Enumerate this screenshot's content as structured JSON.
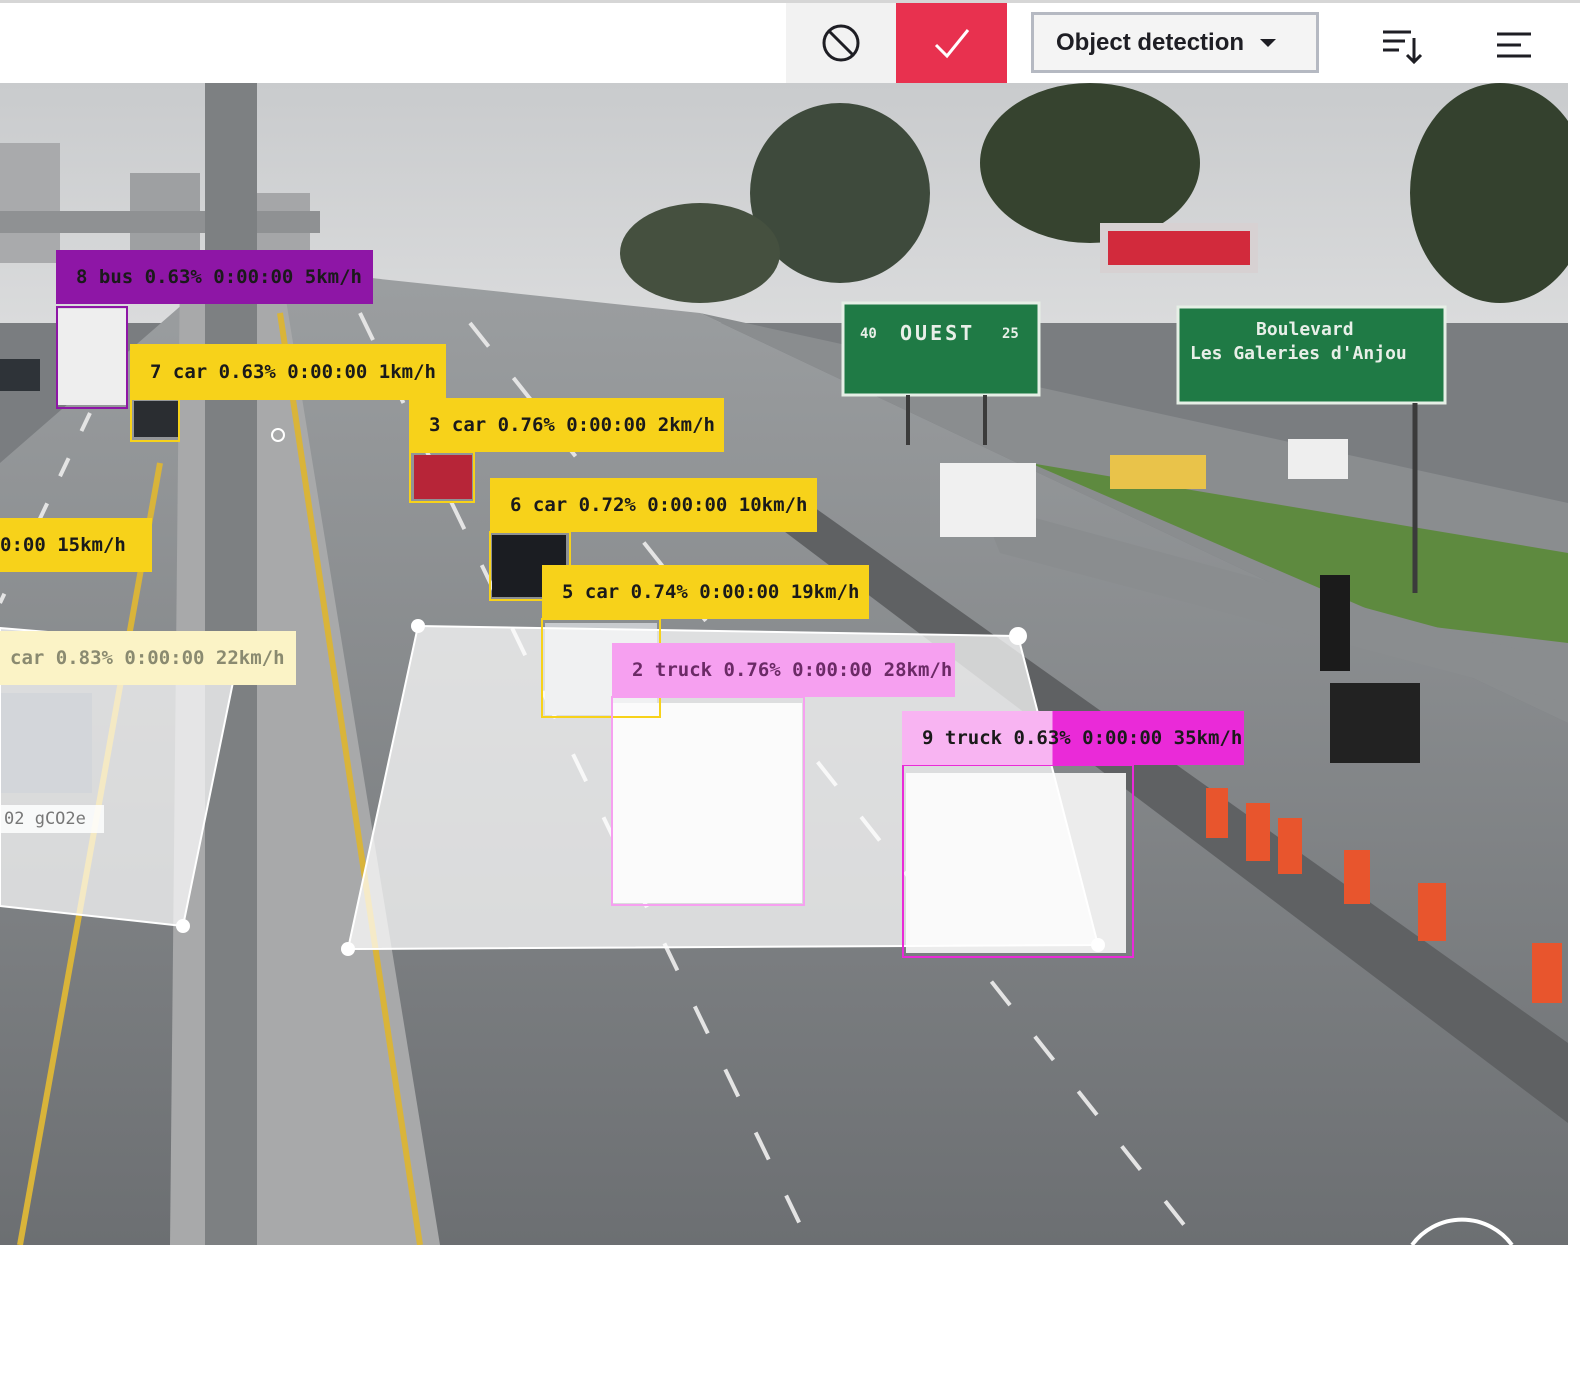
{
  "toolbar": {
    "cancel_icon": "block-icon",
    "confirm_icon": "check-icon",
    "model_select_value": "Object detection",
    "sort_icon": "sort-descending-icon",
    "menu_icon": "menu-icon",
    "accent_color": "#e8314f"
  },
  "video": {
    "detections": [
      {
        "label": "8 bus 0.63% 0:00:00 5km/h",
        "color": "#8e16a6"
      },
      {
        "label": "7 car 0.63% 0:00:00 1km/h",
        "color": "#f7d21a"
      },
      {
        "label": "3 car 0.76% 0:00:00 2km/h",
        "color": "#f7d21a"
      },
      {
        "label": "6 car 0.72% 0:00:00 10km/h",
        "color": "#f7d21a"
      },
      {
        "label": "0:00 15km/h",
        "color": "#f7d21a"
      },
      {
        "label": "5 car 0.74% 0:00:00 19km/h",
        "color": "#f7d21a"
      },
      {
        "label": "car 0.83% 0:00:00 22km/h",
        "color": "#f7d21a"
      },
      {
        "label": "2 truck 0.76% 0:00:00 28km/h",
        "color": "#ea2ad8"
      },
      {
        "label": "9 truck 0.63% 0:00:00 35km/h",
        "color": "#ea2ad8"
      }
    ],
    "co2_label": "02 gCO2e",
    "signs": {
      "ouest_text": "OUEST",
      "route_left": "40",
      "route_right": "25",
      "boulevard_line1": "Boulevard",
      "boulevard_line2": "Les Galeries d'Anjou"
    }
  }
}
